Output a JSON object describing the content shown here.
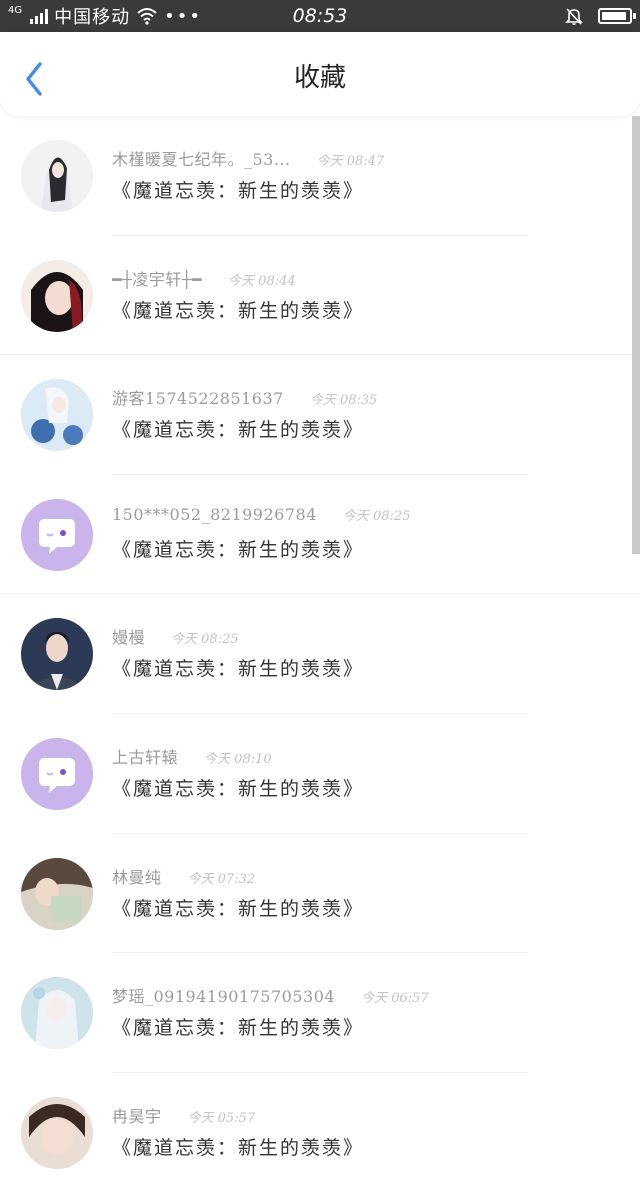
{
  "status_bar": {
    "network": "4G",
    "carrier": "中国移动",
    "dots": "•••",
    "time": "08:53"
  },
  "header": {
    "title": "收藏",
    "back_icon": "chevron-left-icon"
  },
  "favorites": [
    {
      "name": "木槿暖夏七纪年。_53...",
      "time": "今天 08:47",
      "title": "《魔道忘羡：新生的羡羡》"
    },
    {
      "name": "━┼凌宇轩┼━",
      "time": "今天 08:44",
      "title": "《魔道忘羡：新生的羡羡》"
    },
    {
      "name": "游客1574522851637",
      "time": "今天 08:35",
      "title": "《魔道忘羡：新生的羡羡》"
    },
    {
      "name": "150***052_8219926784",
      "time": "今天 08:25",
      "title": "《魔道忘羡：新生的羡羡》"
    },
    {
      "name": "嫚槾",
      "time": "今天 08:25",
      "title": "《魔道忘羡：新生的羡羡》"
    },
    {
      "name": "上古轩辕",
      "time": "今天 08:10",
      "title": "《魔道忘羡：新生的羡羡》"
    },
    {
      "name": "林曼纯",
      "time": "今天 07:32",
      "title": "《魔道忘羡：新生的羡羡》"
    },
    {
      "name": "梦瑶_09194190175705304",
      "time": "今天 06:57",
      "title": "《魔道忘羡：新生的羡羡》"
    },
    {
      "name": "冉昊宇",
      "time": "今天 05:57",
      "title": "《魔道忘羡：新生的羡羡》"
    }
  ],
  "colors": {
    "accent": "#3b8ce8",
    "status_bar_bg": "#3a3a3a",
    "default_avatar": "#c9b4ec"
  }
}
